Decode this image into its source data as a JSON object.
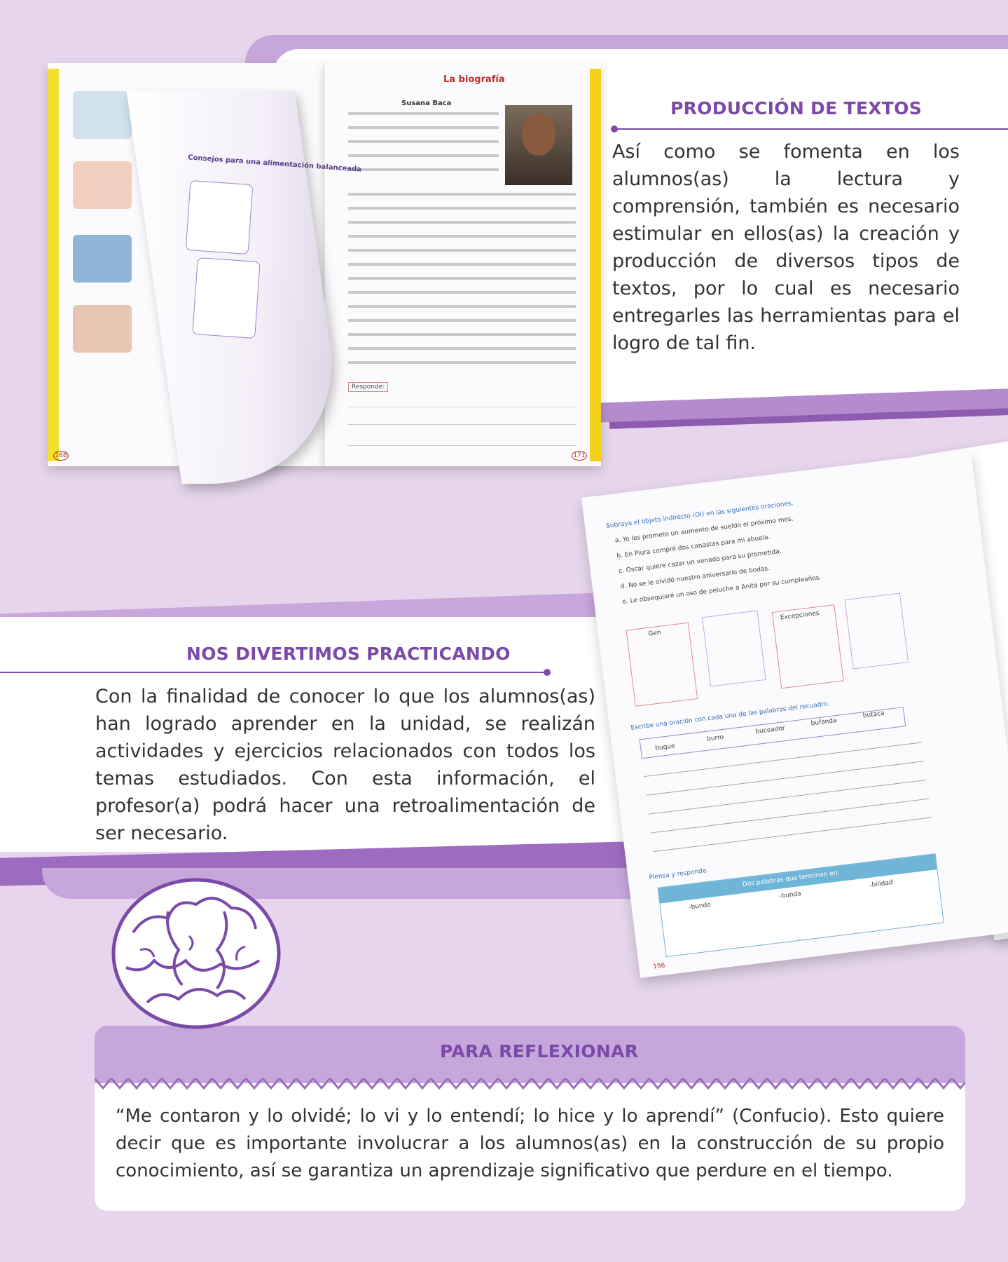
{
  "sections": {
    "produccion": {
      "title": "PRODUCCIÓN DE TEXTOS",
      "body": "Así como se fomenta en los alumnos(as) la lectura y comprensión, también es necesario estimular en ellos(as) la creación y producción de diversos tipos de textos, por lo cual es necesario entregarles las herramientas para el logro de tal fin."
    },
    "divertimos": {
      "title": "NOS DIVERTIMOS PRACTICANDO",
      "body": "Con la finalidad de conocer lo que los alumnos(as) han logrado aprender en la unidad, se realizán actividades y ejercicios relacionados con todos los temas estudiados. Con esta información, el profesor(a) podrá hacer una retroalimentación de ser necesario."
    },
    "reflexionar": {
      "title": "PARA REFLEXIONAR",
      "body": "“Me contaron y lo olvidé; lo vi y lo entendí; lo hice y lo aprendí” (Confucio). Esto quiere decir que es importante involucrar a los alumnos(as) en la construcción de su propio conocimiento, así se garantiza un aprendizaje significativo que perdure en el tiempo."
    }
  },
  "book1": {
    "title": "La biografía",
    "subtitle": "Susana Baca",
    "respond": "Responde:",
    "curl_title": "Consejos para una alimentación balanceada",
    "page_left": "168",
    "page_right": "171"
  },
  "book2": {
    "ex3": "Subraya el objeto indirecto (OI) en las siguientes oraciones.",
    "ex3_items": [
      "a. Yo les prometo un aumento de sueldo el próximo mes.",
      "b. En Piura compré dos canastas para mi abuela.",
      "c. Oscar quiere cazar un venado para su prometida.",
      "d. No se le olvidó nuestro aniversario de bodas.",
      "e. Le obsequiaré un oso de peluche a Anita por su cumpleaños."
    ],
    "gen": "Gen",
    "excepciones": "Excepciones",
    "ex5": "Escribe una oración con cada una de las palabras del recuadro.",
    "words": [
      "buque",
      "burro",
      "buceador",
      "bufanda",
      "butaca"
    ],
    "ex6": "Piensa y responde.",
    "table_head": "Dos palabras que terminan en:",
    "cols": [
      "-bundo",
      "-bunda",
      "-bilidad"
    ],
    "page": "198"
  },
  "colors": {
    "background": "#e6d5ec",
    "accent": "#7b4aa8",
    "band": "#c6a7db"
  }
}
